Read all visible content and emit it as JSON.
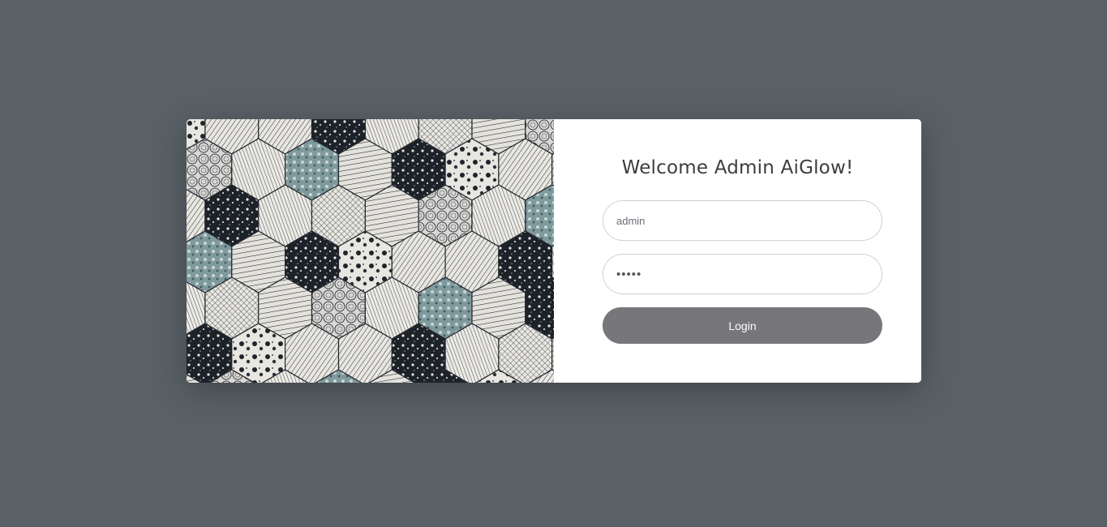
{
  "login": {
    "title": "Welcome Admin AiGlow!",
    "username_value": "admin",
    "password_value": "•••••",
    "button_label": "Login"
  },
  "colors": {
    "background": "#596167",
    "button": "#77767b",
    "card": "#ffffff"
  },
  "icons": {
    "decorative_image": "hexagon-tile-pattern"
  }
}
